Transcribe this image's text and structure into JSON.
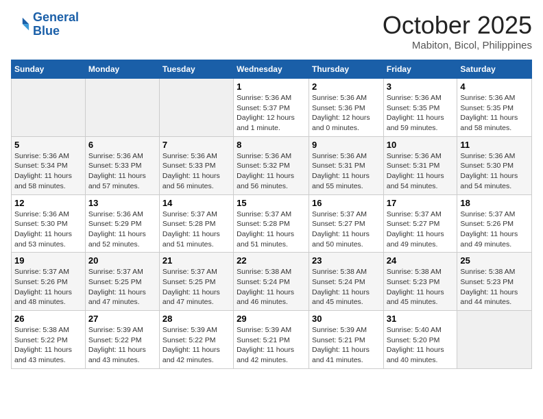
{
  "header": {
    "logo_line1": "General",
    "logo_line2": "Blue",
    "month": "October 2025",
    "location": "Mabiton, Bicol, Philippines"
  },
  "weekdays": [
    "Sunday",
    "Monday",
    "Tuesday",
    "Wednesday",
    "Thursday",
    "Friday",
    "Saturday"
  ],
  "weeks": [
    [
      {
        "day": "",
        "info": ""
      },
      {
        "day": "",
        "info": ""
      },
      {
        "day": "",
        "info": ""
      },
      {
        "day": "1",
        "info": "Sunrise: 5:36 AM\nSunset: 5:37 PM\nDaylight: 12 hours and 1 minute."
      },
      {
        "day": "2",
        "info": "Sunrise: 5:36 AM\nSunset: 5:36 PM\nDaylight: 12 hours and 0 minutes."
      },
      {
        "day": "3",
        "info": "Sunrise: 5:36 AM\nSunset: 5:35 PM\nDaylight: 11 hours and 59 minutes."
      },
      {
        "day": "4",
        "info": "Sunrise: 5:36 AM\nSunset: 5:35 PM\nDaylight: 11 hours and 58 minutes."
      }
    ],
    [
      {
        "day": "5",
        "info": "Sunrise: 5:36 AM\nSunset: 5:34 PM\nDaylight: 11 hours and 58 minutes."
      },
      {
        "day": "6",
        "info": "Sunrise: 5:36 AM\nSunset: 5:33 PM\nDaylight: 11 hours and 57 minutes."
      },
      {
        "day": "7",
        "info": "Sunrise: 5:36 AM\nSunset: 5:33 PM\nDaylight: 11 hours and 56 minutes."
      },
      {
        "day": "8",
        "info": "Sunrise: 5:36 AM\nSunset: 5:32 PM\nDaylight: 11 hours and 56 minutes."
      },
      {
        "day": "9",
        "info": "Sunrise: 5:36 AM\nSunset: 5:31 PM\nDaylight: 11 hours and 55 minutes."
      },
      {
        "day": "10",
        "info": "Sunrise: 5:36 AM\nSunset: 5:31 PM\nDaylight: 11 hours and 54 minutes."
      },
      {
        "day": "11",
        "info": "Sunrise: 5:36 AM\nSunset: 5:30 PM\nDaylight: 11 hours and 54 minutes."
      }
    ],
    [
      {
        "day": "12",
        "info": "Sunrise: 5:36 AM\nSunset: 5:30 PM\nDaylight: 11 hours and 53 minutes."
      },
      {
        "day": "13",
        "info": "Sunrise: 5:36 AM\nSunset: 5:29 PM\nDaylight: 11 hours and 52 minutes."
      },
      {
        "day": "14",
        "info": "Sunrise: 5:37 AM\nSunset: 5:28 PM\nDaylight: 11 hours and 51 minutes."
      },
      {
        "day": "15",
        "info": "Sunrise: 5:37 AM\nSunset: 5:28 PM\nDaylight: 11 hours and 51 minutes."
      },
      {
        "day": "16",
        "info": "Sunrise: 5:37 AM\nSunset: 5:27 PM\nDaylight: 11 hours and 50 minutes."
      },
      {
        "day": "17",
        "info": "Sunrise: 5:37 AM\nSunset: 5:27 PM\nDaylight: 11 hours and 49 minutes."
      },
      {
        "day": "18",
        "info": "Sunrise: 5:37 AM\nSunset: 5:26 PM\nDaylight: 11 hours and 49 minutes."
      }
    ],
    [
      {
        "day": "19",
        "info": "Sunrise: 5:37 AM\nSunset: 5:26 PM\nDaylight: 11 hours and 48 minutes."
      },
      {
        "day": "20",
        "info": "Sunrise: 5:37 AM\nSunset: 5:25 PM\nDaylight: 11 hours and 47 minutes."
      },
      {
        "day": "21",
        "info": "Sunrise: 5:37 AM\nSunset: 5:25 PM\nDaylight: 11 hours and 47 minutes."
      },
      {
        "day": "22",
        "info": "Sunrise: 5:38 AM\nSunset: 5:24 PM\nDaylight: 11 hours and 46 minutes."
      },
      {
        "day": "23",
        "info": "Sunrise: 5:38 AM\nSunset: 5:24 PM\nDaylight: 11 hours and 45 minutes."
      },
      {
        "day": "24",
        "info": "Sunrise: 5:38 AM\nSunset: 5:23 PM\nDaylight: 11 hours and 45 minutes."
      },
      {
        "day": "25",
        "info": "Sunrise: 5:38 AM\nSunset: 5:23 PM\nDaylight: 11 hours and 44 minutes."
      }
    ],
    [
      {
        "day": "26",
        "info": "Sunrise: 5:38 AM\nSunset: 5:22 PM\nDaylight: 11 hours and 43 minutes."
      },
      {
        "day": "27",
        "info": "Sunrise: 5:39 AM\nSunset: 5:22 PM\nDaylight: 11 hours and 43 minutes."
      },
      {
        "day": "28",
        "info": "Sunrise: 5:39 AM\nSunset: 5:22 PM\nDaylight: 11 hours and 42 minutes."
      },
      {
        "day": "29",
        "info": "Sunrise: 5:39 AM\nSunset: 5:21 PM\nDaylight: 11 hours and 42 minutes."
      },
      {
        "day": "30",
        "info": "Sunrise: 5:39 AM\nSunset: 5:21 PM\nDaylight: 11 hours and 41 minutes."
      },
      {
        "day": "31",
        "info": "Sunrise: 5:40 AM\nSunset: 5:20 PM\nDaylight: 11 hours and 40 minutes."
      },
      {
        "day": "",
        "info": ""
      }
    ]
  ]
}
